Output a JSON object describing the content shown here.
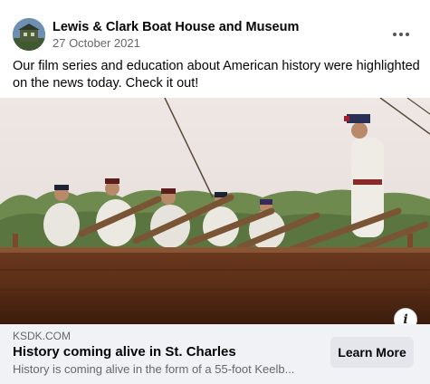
{
  "post": {
    "page_name": "Lewis & Clark Boat House and Museum",
    "date": "27 October 2021",
    "text": "Our film series and education about American history were highlighted on the news today.  Check it out!",
    "more_icon": "more-horizontal-icon"
  },
  "media": {
    "info_icon_glyph": "i"
  },
  "link": {
    "domain": "KSDK.COM",
    "title": "History coming alive in St. Charles",
    "description": "History is coming alive in the form of a 55-foot Keelb...",
    "button": "Learn More"
  },
  "colors": {
    "secondary_text": "#65676b",
    "link_bar_bg": "#f0f2f5",
    "button_bg": "#e4e6eb"
  }
}
